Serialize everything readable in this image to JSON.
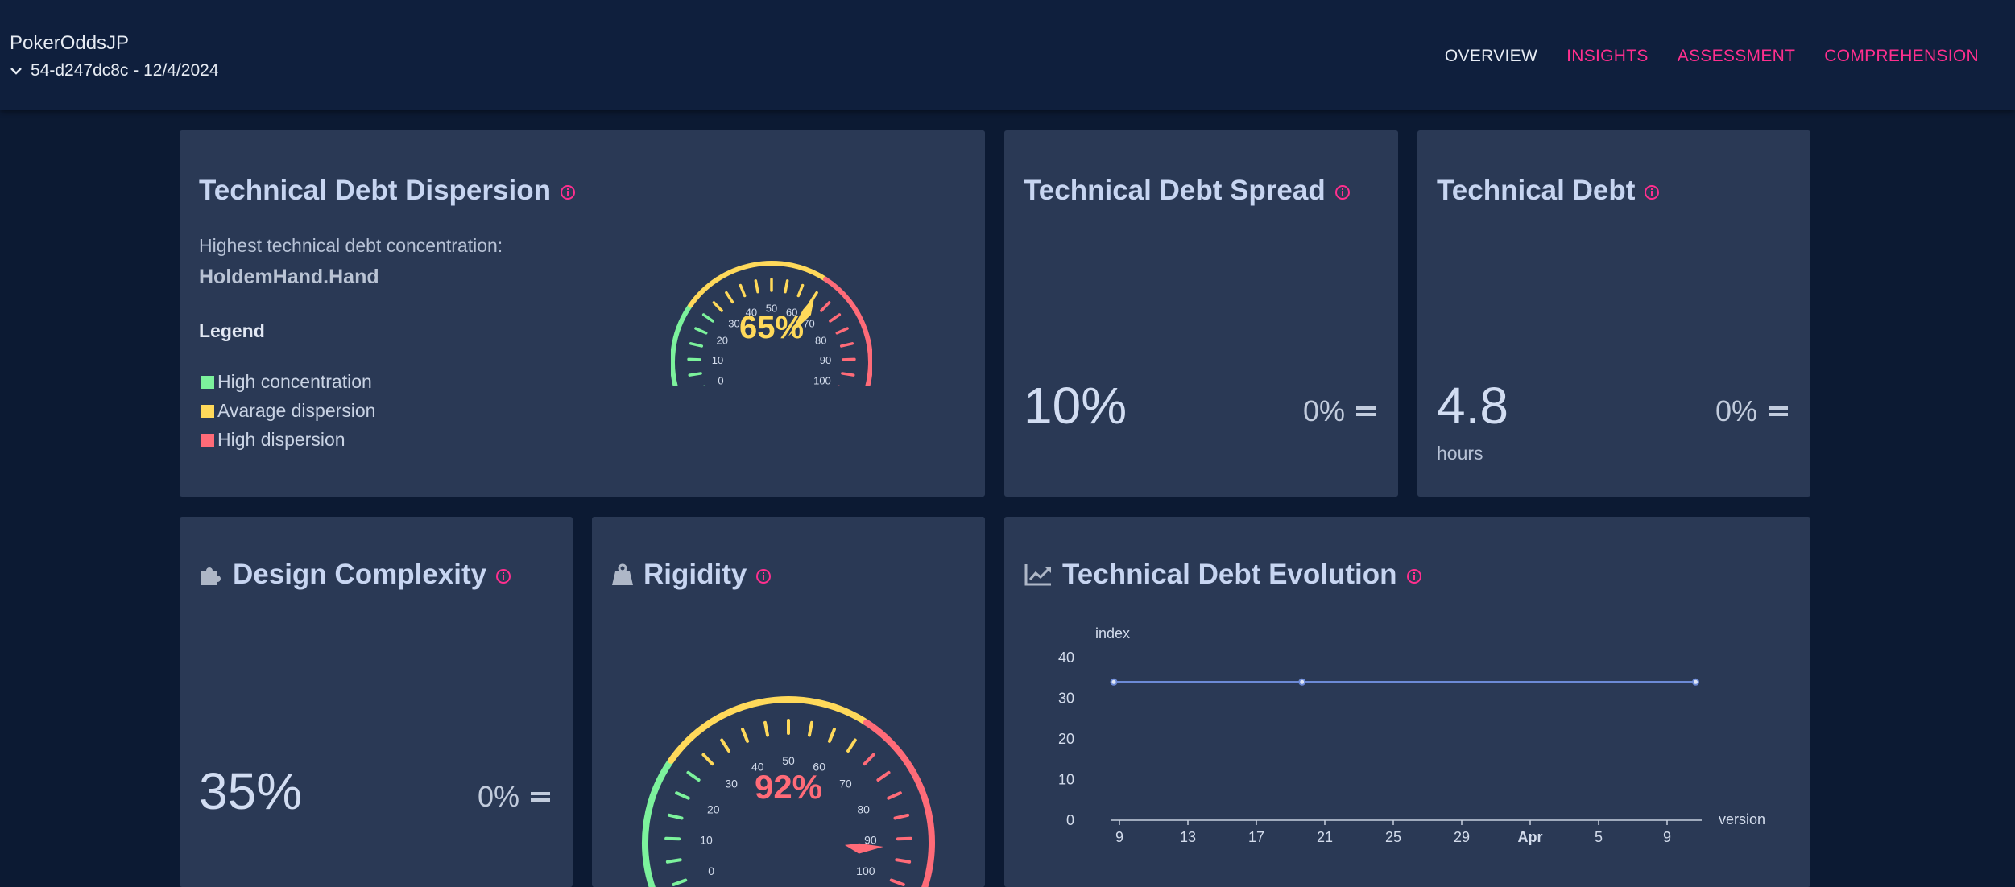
{
  "app": {
    "title": "PokerOddsJP",
    "version": "54-d247dc8c - 12/4/2024"
  },
  "nav": [
    {
      "label": "OVERVIEW",
      "active": true
    },
    {
      "label": "INSIGHTS",
      "active": false
    },
    {
      "label": "ASSESSMENT",
      "active": false
    },
    {
      "label": "COMPREHENSION",
      "active": false
    }
  ],
  "dispersion": {
    "title": "Technical Debt Dispersion",
    "concentration_label": "Highest technical debt concentration:",
    "concentration_value": "HoldemHand.Hand",
    "legend_title": "Legend",
    "legend": [
      {
        "label": "High concentration",
        "color": "#7cf29c"
      },
      {
        "label": "Avarage dispersion",
        "color": "#ffd95a"
      },
      {
        "label": "High dispersion",
        "color": "#ff6b78"
      }
    ],
    "gauge_value": 65,
    "gauge_text": "65%"
  },
  "spread": {
    "title": "Technical Debt Spread",
    "value": "10%",
    "delta": "0%"
  },
  "debt": {
    "title": "Technical Debt",
    "value": "4.8",
    "unit": "hours",
    "delta": "0%"
  },
  "complexity": {
    "title": "Design Complexity",
    "value": "35%",
    "delta": "0%"
  },
  "rigidity": {
    "title": "Rigidity",
    "gauge_value": 92,
    "gauge_text": "92%"
  },
  "evolution": {
    "title": "Technical Debt Evolution"
  },
  "gauge_ticks": [
    "0",
    "10",
    "20",
    "30",
    "40",
    "50",
    "60",
    "70",
    "80",
    "90",
    "100"
  ],
  "colors": {
    "green": "#7cf29c",
    "yellow": "#ffd95a",
    "red": "#ff6b78",
    "line": "#6c8ad6"
  },
  "chart_data": {
    "type": "line",
    "xlabel": "version",
    "ylabel": "index",
    "ylim": [
      0,
      40
    ],
    "yticks": [
      "0",
      "10",
      "20",
      "30",
      "40"
    ],
    "xticks": [
      "9",
      "13",
      "17",
      "21",
      "25",
      "29",
      "Apr",
      "5",
      "9"
    ],
    "series": [
      {
        "x": [
          "Mar 9",
          "Mar 20",
          "Apr 12"
        ],
        "values": [
          34,
          34,
          34
        ]
      }
    ]
  }
}
